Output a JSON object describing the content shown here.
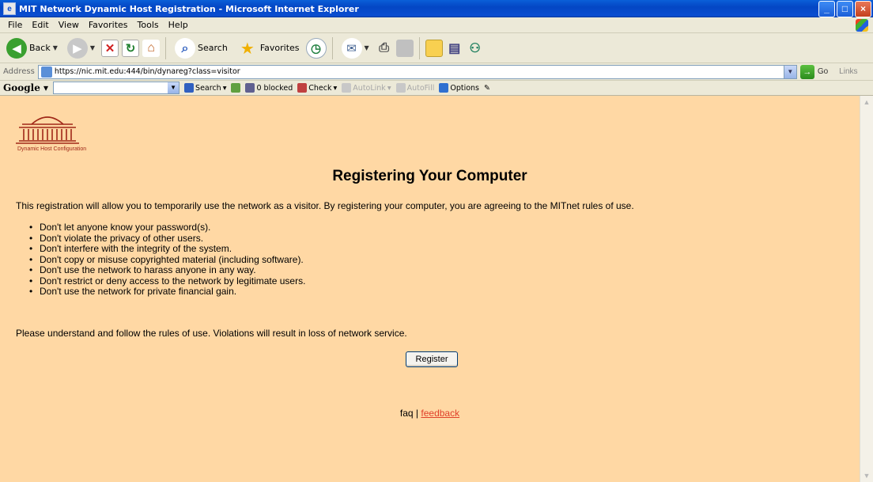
{
  "window": {
    "title": "MIT Network Dynamic Host Registration - Microsoft Internet Explorer",
    "controls": {
      "minimize": "_",
      "maximize": "□",
      "close": "×"
    }
  },
  "menubar": {
    "items": [
      "File",
      "Edit",
      "View",
      "Favorites",
      "Tools",
      "Help"
    ]
  },
  "toolbar": {
    "back_label": "Back",
    "search_label": "Search",
    "favorites_label": "Favorites"
  },
  "address_bar": {
    "label": "Address",
    "url": "https://nic.mit.edu:444/bin/dynareg?class=visitor",
    "go_label": "Go",
    "links_label": "Links"
  },
  "google_toolbar": {
    "logo": "Google",
    "search_label": "Search",
    "blocked_label": "0 blocked",
    "check_label": "Check",
    "autolink_label": "AutoLink",
    "autofill_label": "AutoFill",
    "options_label": "Options"
  },
  "page": {
    "logo_caption": "Dynamic Host Configuration",
    "heading": "Registering Your Computer",
    "intro": "This registration will allow you to temporarily use the network as a visitor. By registering your computer, you are agreeing to the MITnet rules of use.",
    "rules": [
      "Don't let anyone know your password(s).",
      "Don't violate the privacy of other users.",
      "Don't interfere with the integrity of the system.",
      "Don't copy or misuse copyrighted material (including software).",
      "Don't use the network to harass anyone in any way.",
      "Don't restrict or deny access to the network by legitimate users.",
      "Don't use the network for private financial gain."
    ],
    "closing": "Please understand and follow the rules of use. Violations will result in loss of network service.",
    "register_button": "Register",
    "footer": {
      "faq": "faq",
      "separator": " | ",
      "feedback": "feedback"
    }
  },
  "colors": {
    "page_background": "#ffd8a4",
    "link_color": "#e0402a",
    "logo_color": "#a02818"
  }
}
